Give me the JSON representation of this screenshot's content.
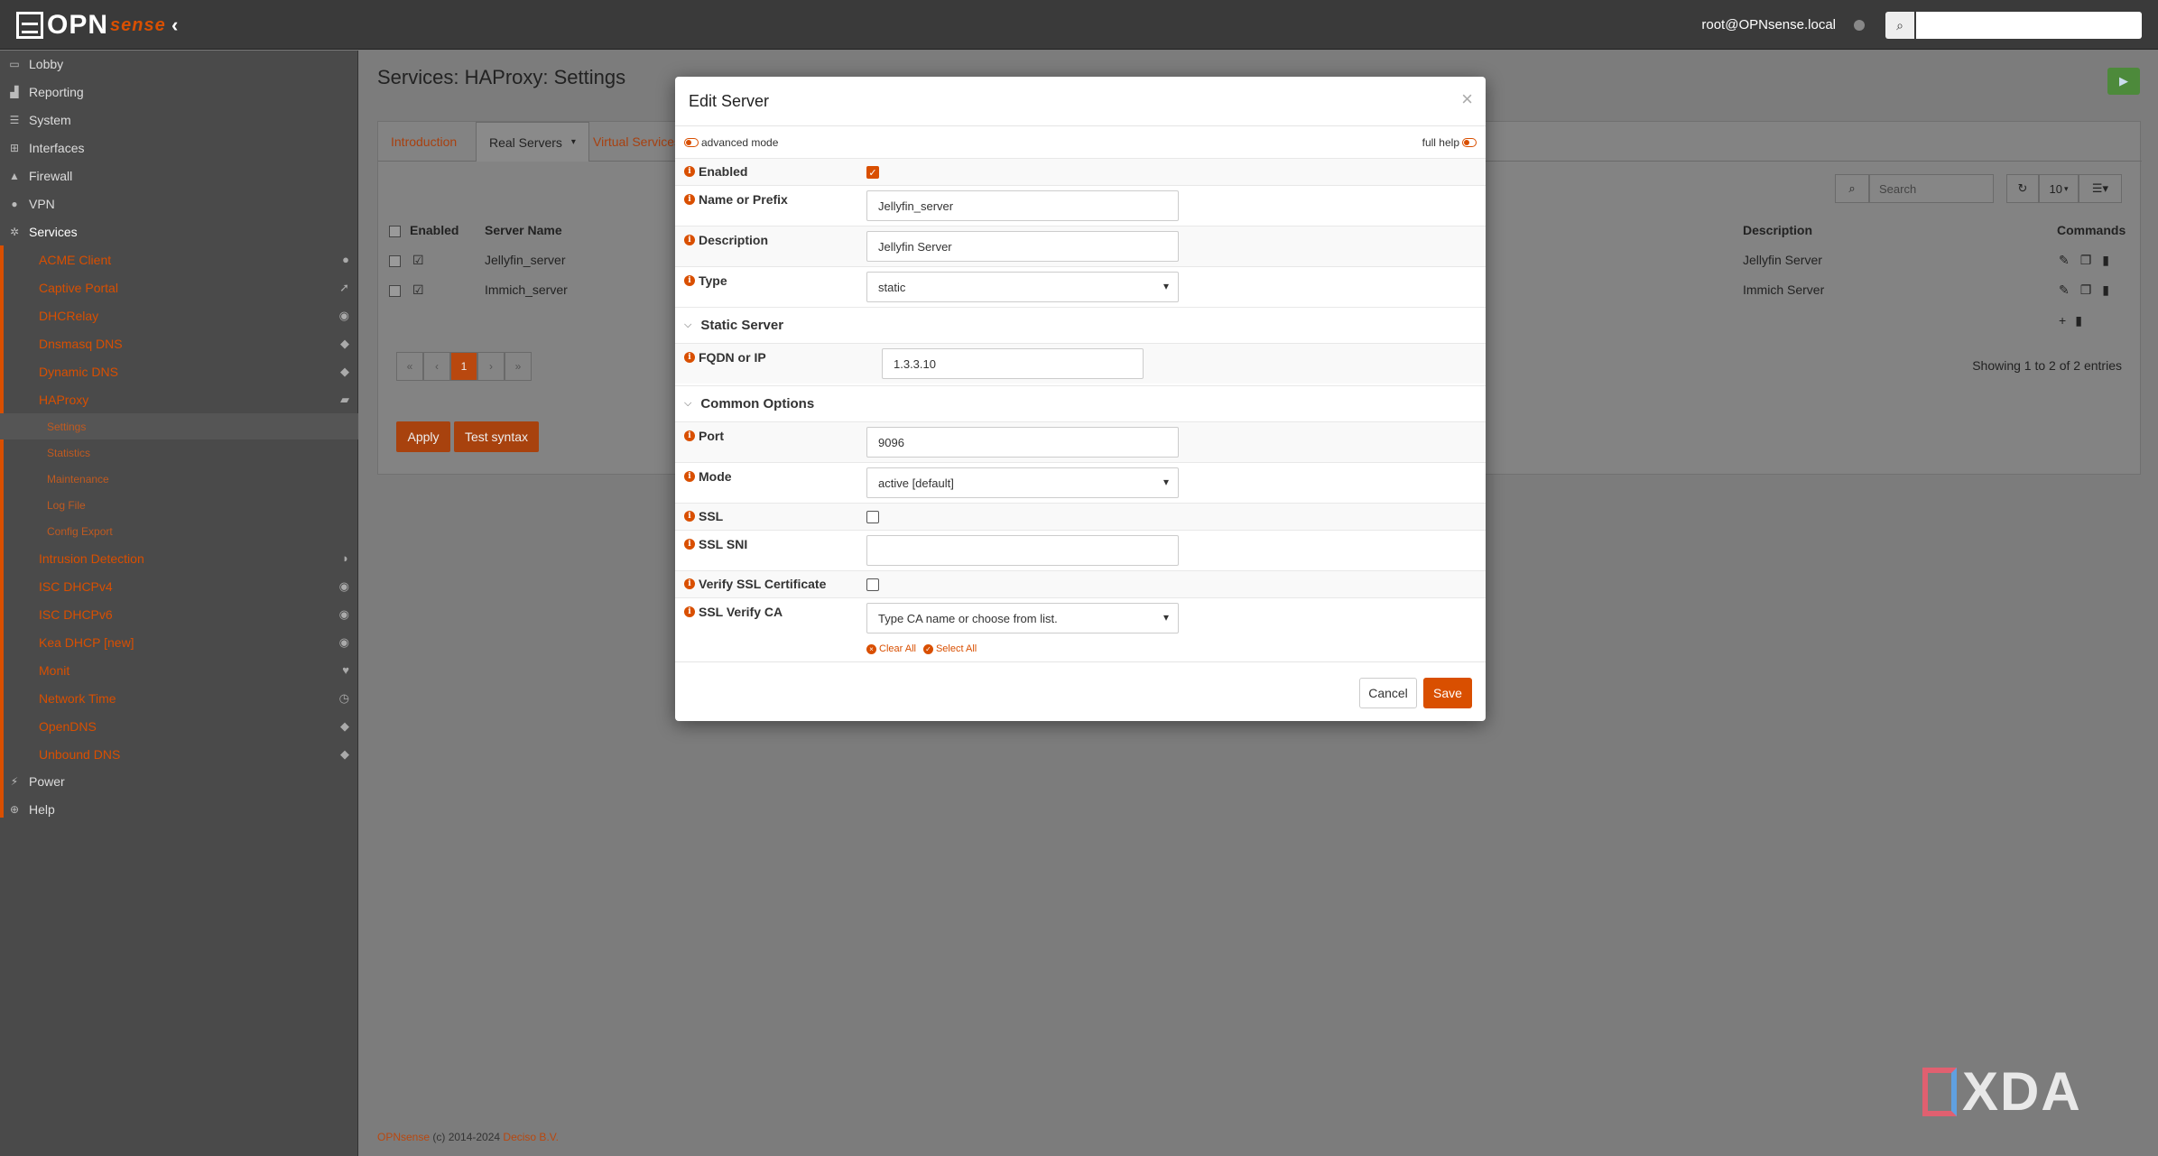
{
  "topbar": {
    "logo_main": "OPN",
    "logo_sense": "sense",
    "user": "root@OPNsense.local"
  },
  "sidebar": {
    "items": [
      {
        "label": "Lobby",
        "icon": "laptop-icon"
      },
      {
        "label": "Reporting",
        "icon": "chart-icon"
      },
      {
        "label": "System",
        "icon": "server-icon"
      },
      {
        "label": "Interfaces",
        "icon": "sitemap-icon"
      },
      {
        "label": "Firewall",
        "icon": "fire-icon"
      },
      {
        "label": "VPN",
        "icon": "globe-icon"
      },
      {
        "label": "Services",
        "icon": "gear-icon"
      }
    ],
    "services": [
      {
        "label": "ACME Client",
        "icon": "circle-icon"
      },
      {
        "label": "Captive Portal",
        "icon": "paper-plane-icon"
      },
      {
        "label": "DHCRelay",
        "icon": "bullseye-icon"
      },
      {
        "label": "Dnsmasq DNS",
        "icon": "tags-icon"
      },
      {
        "label": "Dynamic DNS",
        "icon": "tags-icon"
      },
      {
        "label": "HAProxy",
        "icon": "truck-icon"
      }
    ],
    "haproxy_sub": [
      "Settings",
      "Statistics",
      "Maintenance",
      "Log File",
      "Config Export"
    ],
    "services_more": [
      {
        "label": "Intrusion Detection",
        "icon": "shield-icon"
      },
      {
        "label": "ISC DHCPv4",
        "icon": "bullseye-icon"
      },
      {
        "label": "ISC DHCPv6",
        "icon": "bullseye-icon"
      },
      {
        "label": "Kea DHCP [new]",
        "icon": "bullseye-icon"
      },
      {
        "label": "Monit",
        "icon": "heartbeat-icon"
      },
      {
        "label": "Network Time",
        "icon": "clock-icon"
      },
      {
        "label": "OpenDNS",
        "icon": "tags-icon"
      },
      {
        "label": "Unbound DNS",
        "icon": "tags-icon"
      }
    ],
    "bottom": [
      {
        "label": "Power",
        "icon": "plug-icon"
      },
      {
        "label": "Help",
        "icon": "lifebuoy-icon"
      }
    ]
  },
  "main": {
    "title": "Services: HAProxy: Settings",
    "tabs": [
      "Introduction",
      "Real Servers",
      "Virtual Services"
    ],
    "search_placeholder": "Search",
    "page_size": "10",
    "columns": [
      "Enabled",
      "Server Name",
      "Description",
      "Commands"
    ],
    "rows": [
      {
        "name": "Jellyfin_server",
        "description": "Jellyfin Server"
      },
      {
        "name": "Immich_server",
        "description": "Immich Server"
      }
    ],
    "pager": [
      "«",
      "‹",
      "1",
      "›",
      "»"
    ],
    "showing": "Showing 1 to 2 of 2 entries",
    "apply_label": "Apply",
    "test_label": "Test syntax",
    "footer_brand": "OPNsense",
    "footer_text": " (c) 2014-2024 ",
    "footer_company": "Deciso B.V."
  },
  "modal": {
    "title": "Edit Server",
    "close": "×",
    "advanced_mode": "advanced mode",
    "full_help": "full help",
    "fields": {
      "enabled_label": "Enabled",
      "name_label": "Name or Prefix",
      "name_value": "Jellyfin_server",
      "description_label": "Description",
      "description_value": "Jellyfin Server",
      "type_label": "Type",
      "type_value": "static",
      "static_section": "Static Server",
      "fqdn_label": "FQDN or IP",
      "fqdn_value": "1.3.3.10",
      "common_section": "Common Options",
      "port_label": "Port",
      "port_value": "9096",
      "mode_label": "Mode",
      "mode_value": "active [default]",
      "ssl_label": "SSL",
      "ssl_sni_label": "SSL SNI",
      "ssl_sni_value": "",
      "verify_label": "Verify SSL Certificate",
      "verify_ca_label": "SSL Verify CA",
      "verify_ca_placeholder": "Type CA name or choose from list.",
      "clear_all": "Clear All",
      "select_all": "Select All"
    },
    "cancel_label": "Cancel",
    "save_label": "Save"
  },
  "watermark": "XDA",
  "colors": {
    "accent": "#d94f00",
    "topbar": "#3a3a3a",
    "sidebar": "#4a4a4a"
  }
}
